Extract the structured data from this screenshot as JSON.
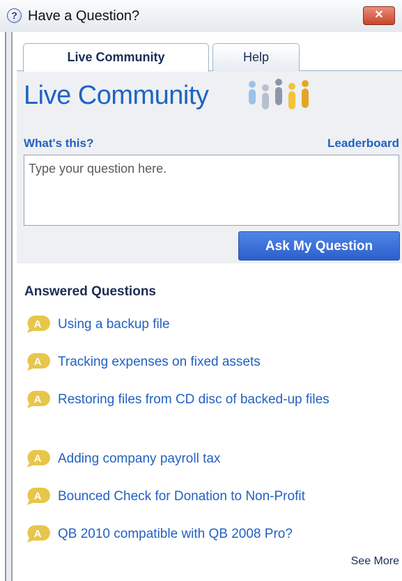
{
  "window": {
    "title": "Have a Question?",
    "help_icon": "?",
    "close_icon": "✕"
  },
  "tabs": [
    {
      "label": "Live Community",
      "active": true
    },
    {
      "label": "Help",
      "active": false
    }
  ],
  "brand": {
    "text": "Live Community",
    "logo_icon": "people-group-icon",
    "colors": {
      "brand_blue": "#1e63c4",
      "people": [
        "#9bc1e8",
        "#b7bfd0",
        "#8e96ab",
        "#f2c33b",
        "#e3a628"
      ]
    }
  },
  "links": {
    "whats_this": "What's this?",
    "leaderboard": "Leaderboard"
  },
  "question_input": {
    "placeholder": "Type your question here.",
    "value": ""
  },
  "ask_button": "Ask My Question",
  "answered": {
    "title": "Answered Questions",
    "badge_letter": "A",
    "badge_color": "#e8c64a",
    "items": [
      {
        "text": "Using a backup file"
      },
      {
        "text": "Tracking expenses on fixed assets"
      },
      {
        "text": "Restoring files from CD disc of backed-up files"
      },
      {
        "text": "Adding company payroll tax"
      },
      {
        "text": "Bounced Check for Donation to Non-Profit"
      },
      {
        "text": "QB 2010 compatible with QB 2008 Pro?"
      }
    ],
    "see_more": "See More"
  }
}
